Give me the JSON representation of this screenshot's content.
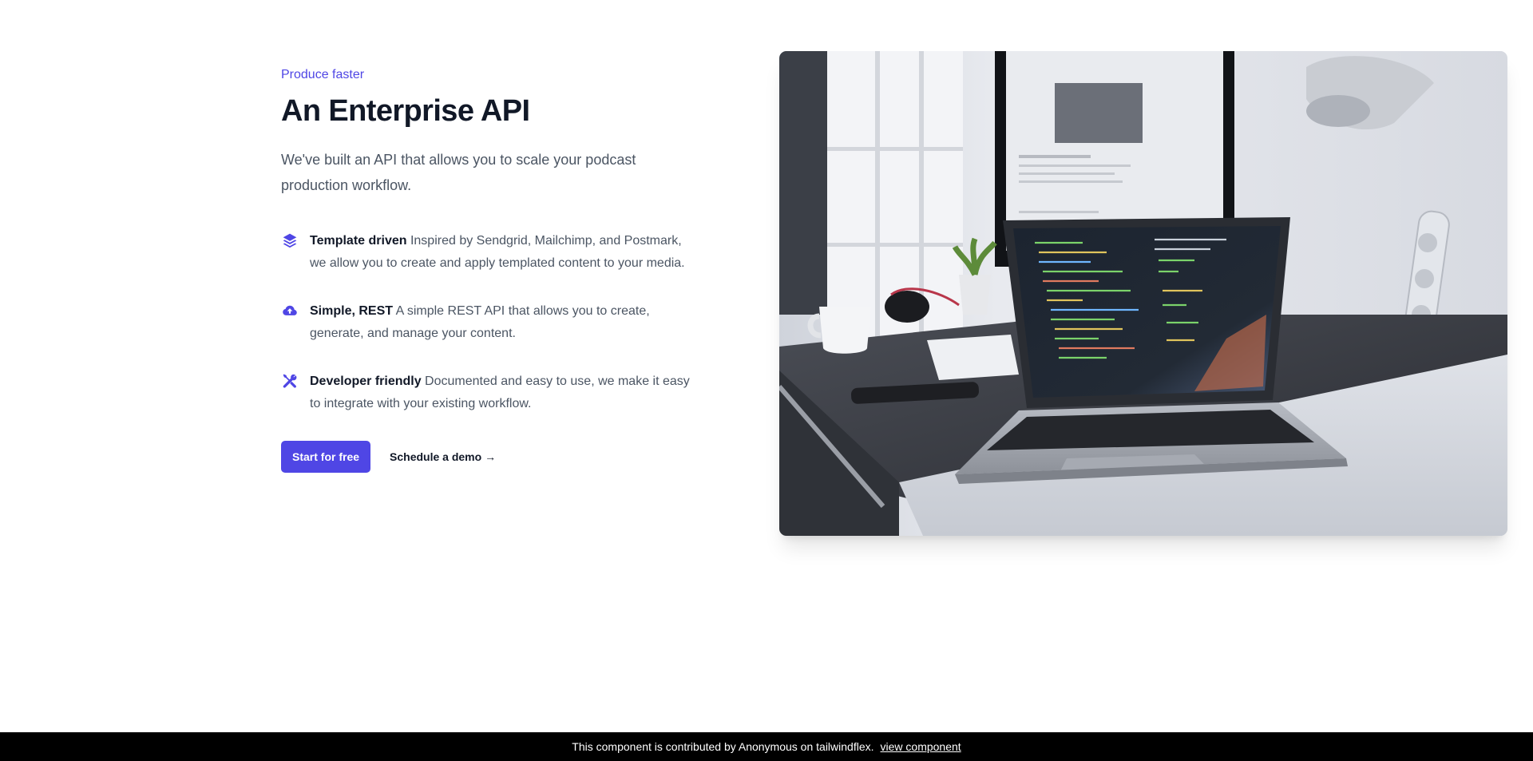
{
  "hero": {
    "eyebrow": "Produce faster",
    "title": "An Enterprise API",
    "subtitle": "We've built an API that allows you to scale your podcast production workflow."
  },
  "features": [
    {
      "icon": "layers-icon",
      "name": "Template driven",
      "description": " Inspired by Sendgrid, Mailchimp, and Postmark, we allow you to create and apply templated content to your media."
    },
    {
      "icon": "cloud-upload-icon",
      "name": "Simple, REST",
      "description": " A simple REST API that allows you to create, generate, and manage your content."
    },
    {
      "icon": "tools-icon",
      "name": "Developer friendly",
      "description": " Documented and easy to use, we make it easy to integrate with your existing workflow."
    }
  ],
  "actions": {
    "primary_label": "Start for free",
    "secondary_label": "Schedule a demo →"
  },
  "image": {
    "alt": "Laptop with code on a desk"
  },
  "footer": {
    "text": "This component is contributed by Anonymous on tailwindflex.",
    "link_label": "view component"
  },
  "colors": {
    "accent": "#4f46e5",
    "heading": "#111827",
    "body": "#4b5563",
    "footer_bg": "#000000"
  }
}
